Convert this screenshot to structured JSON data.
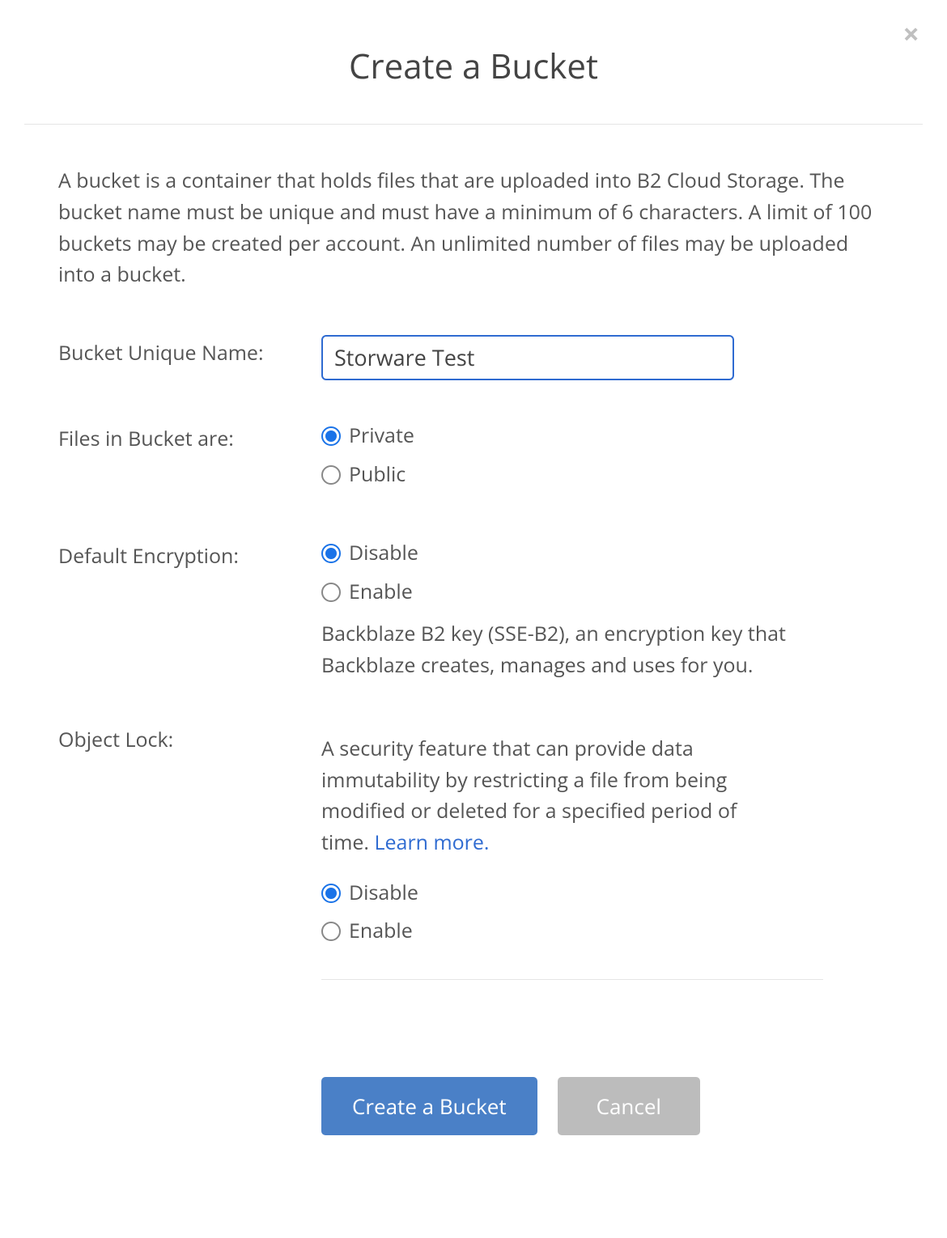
{
  "modal": {
    "title": "Create a Bucket",
    "description": "A bucket is a container that holds files that are uploaded into B2 Cloud Storage. The bucket name must be unique and must have a minimum of 6 characters. A limit of 100 buckets may be created per account. An unlimited number of files may be uploaded into a bucket.",
    "fields": {
      "bucket_name": {
        "label": "Bucket Unique Name:",
        "value": "Storware Test"
      },
      "files_privacy": {
        "label": "Files in Bucket are:",
        "options": {
          "private": "Private",
          "public": "Public"
        },
        "selected": "private"
      },
      "encryption": {
        "label": "Default Encryption:",
        "options": {
          "disable": "Disable",
          "enable": "Enable"
        },
        "selected": "disable",
        "helper": "Backblaze B2 key (SSE-B2), an encryption key that Backblaze creates, manages and uses for you."
      },
      "object_lock": {
        "label": "Object Lock:",
        "description_prefix": "A security feature that can provide data immutability by restricting a file from being modified or deleted for a specified period of time. ",
        "learn_more": "Learn more.",
        "options": {
          "disable": "Disable",
          "enable": "Enable"
        },
        "selected": "disable"
      }
    },
    "buttons": {
      "create": "Create a Bucket",
      "cancel": "Cancel"
    }
  }
}
